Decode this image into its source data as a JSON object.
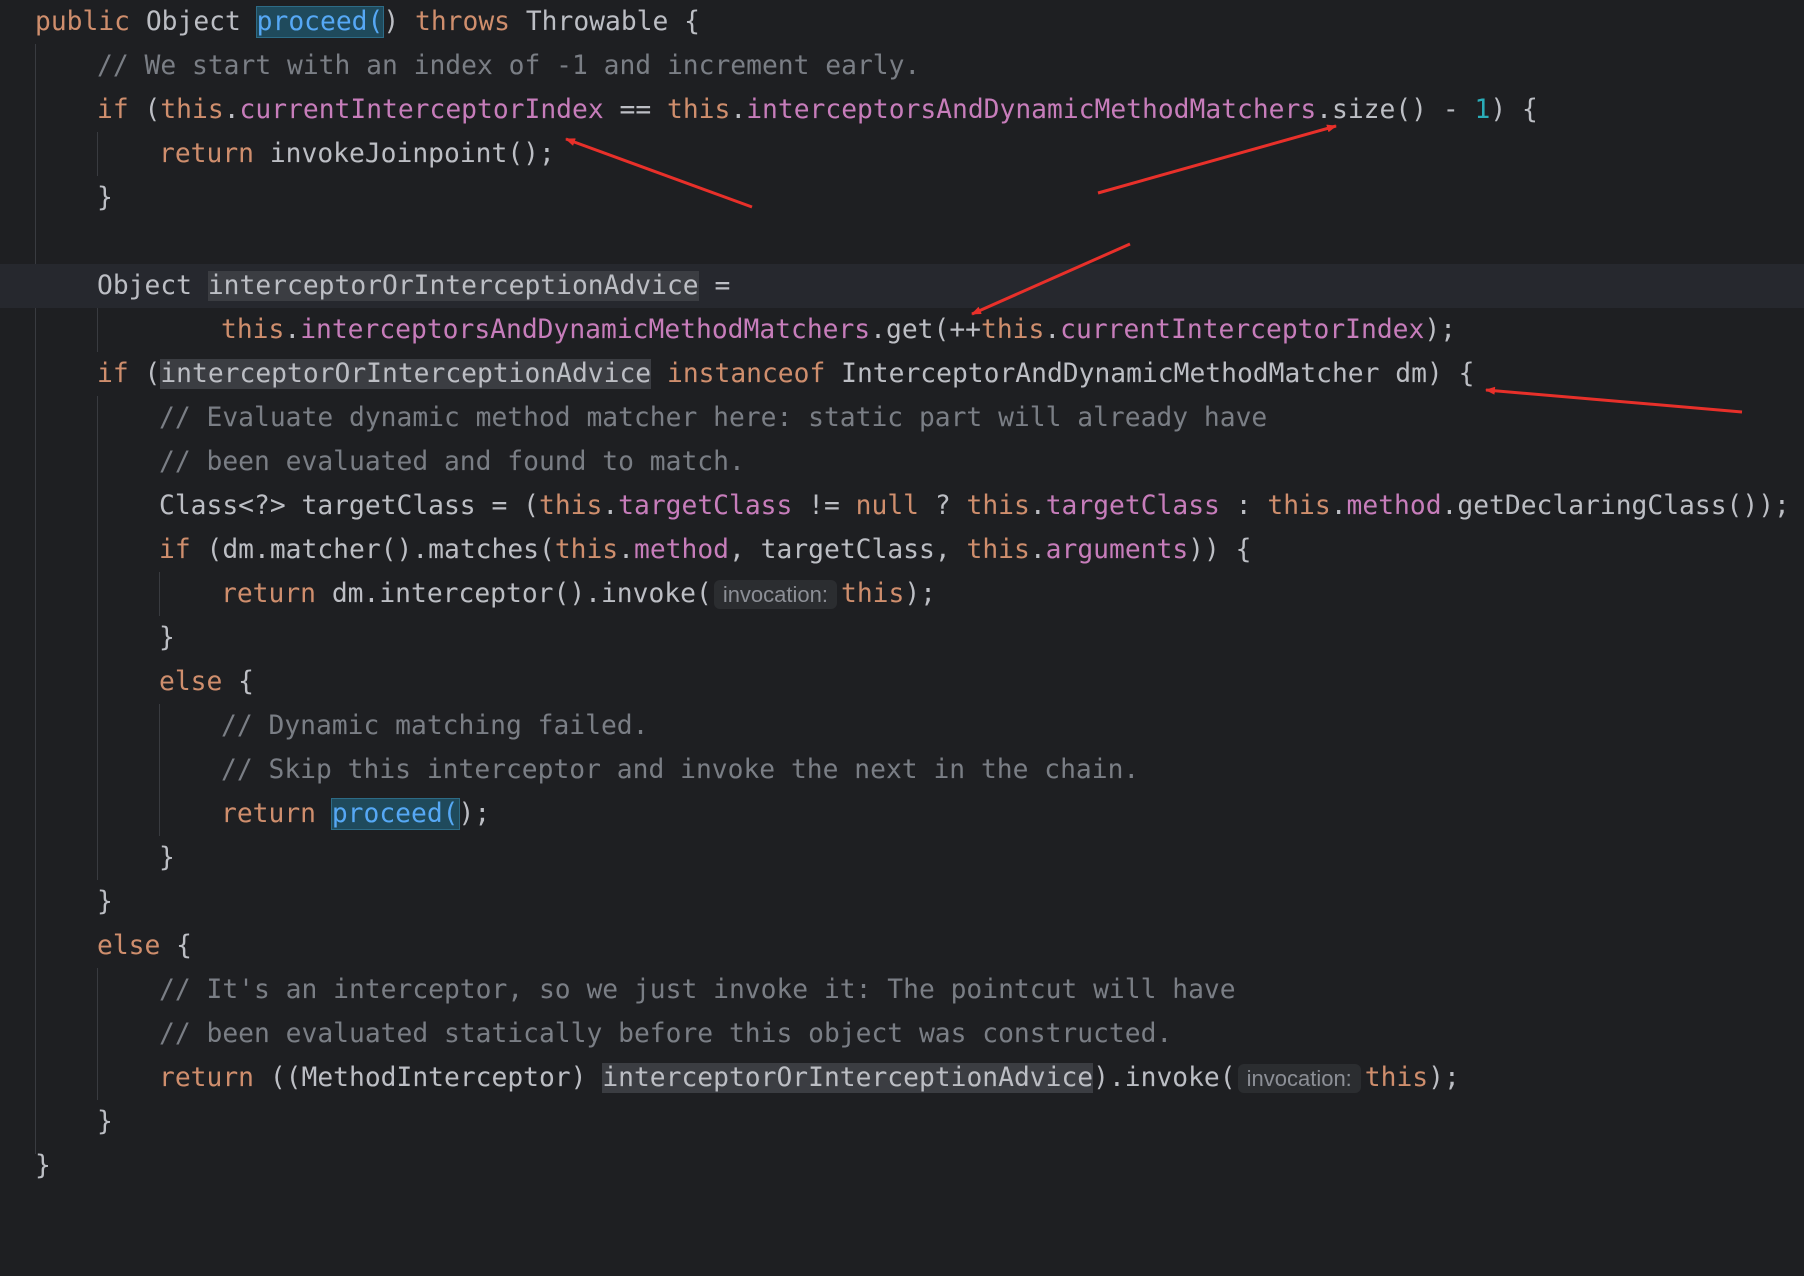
{
  "colors": {
    "background": "#1e1f22",
    "current_line": "#26282e",
    "keyword": "#cf8e6d",
    "field": "#c77dbb",
    "comment": "#7a7e85",
    "number": "#2aacb8",
    "method_highlight": "#56a8f5",
    "annotation_arrow": "#e8302a"
  },
  "code": {
    "l1": {
      "kw1": "public",
      "t1": " Object ",
      "sel": "proceed(",
      "t2": ") ",
      "kw2": "throws",
      "t3": " Throwable {"
    },
    "l2": {
      "comment": "// We start with an index of -1 and increment early."
    },
    "l3": {
      "kw1": "if",
      "t1": " (",
      "this1": "this",
      "dot1": ".",
      "f1": "currentInterceptorIndex",
      "t2": " == ",
      "this2": "this",
      "dot2": ".",
      "f2": "interceptorsAndDynamicMethodMatchers",
      "t3": ".size() - ",
      "num": "1",
      "t4": ") {"
    },
    "l4": {
      "kw": "return",
      "t": " invokeJoinpoint();"
    },
    "l5": {
      "t": "}"
    },
    "l7": {
      "t1": "Object ",
      "var": "interceptorOrInterceptionAdvice",
      "t2": " ="
    },
    "l8": {
      "this1": "this",
      "dot1": ".",
      "f1": "interceptorsAndDynamicMethodMatchers",
      "t1": ".get(++",
      "this2": "this",
      "dot2": ".",
      "f2": "currentInterceptorIndex",
      "t2": ");"
    },
    "l9": {
      "kw1": "if",
      "t1": " (",
      "var": "interceptorOrInterceptionAdvice",
      "t2": " ",
      "kw2": "instanceof",
      "t3": " InterceptorAndDynamicMethodMatcher dm) {"
    },
    "l10": {
      "comment": "// Evaluate dynamic method matcher here: static part will already have"
    },
    "l11": {
      "comment": "// been evaluated and found to match."
    },
    "l12": {
      "t1": "Class<?> targetClass = (",
      "this1": "this",
      "dot1": ".",
      "f1": "targetClass",
      "t2": " != ",
      "kw": "null",
      "t3": " ? ",
      "this2": "this",
      "dot2": ".",
      "f2": "targetClass",
      "t4": " : ",
      "this3": "this",
      "dot3": ".",
      "f3": "method",
      "t5": ".getDeclaringClass());"
    },
    "l13": {
      "kw": "if",
      "t1": " (dm.matcher().matches(",
      "this1": "this",
      "dot1": ".",
      "f1": "method",
      "t2": ", targetClass, ",
      "this2": "this",
      "dot2": ".",
      "f2": "arguments",
      "t3": ")) {"
    },
    "l14": {
      "kw": "return",
      "t1": " dm.interceptor().invoke(",
      "hint": "invocation:",
      "this1": "this",
      "t2": ");"
    },
    "l15": {
      "t": "}"
    },
    "l16": {
      "kw": "else",
      "t": " {"
    },
    "l17": {
      "comment": "// Dynamic matching failed."
    },
    "l18": {
      "comment": "// Skip this interceptor and invoke the next in the chain."
    },
    "l19": {
      "kw": "return",
      "t1": " ",
      "sel": "proceed(",
      "t2": ");"
    },
    "l20": {
      "t": "}"
    },
    "l21": {
      "t": "}"
    },
    "l22": {
      "kw": "else",
      "t": " {"
    },
    "l23": {
      "comment": "// It's an interceptor, so we just invoke it: The pointcut will have"
    },
    "l24": {
      "comment": "// been evaluated statically before this object was constructed."
    },
    "l25": {
      "kw": "return",
      "t1": " ((MethodInterceptor) ",
      "var": "interceptorOrInterceptionAdvice",
      "t2": ").invoke(",
      "hint": "invocation:",
      "this1": "this",
      "t3": ");"
    },
    "l26": {
      "t": "}"
    },
    "l27": {
      "t": "}"
    }
  }
}
